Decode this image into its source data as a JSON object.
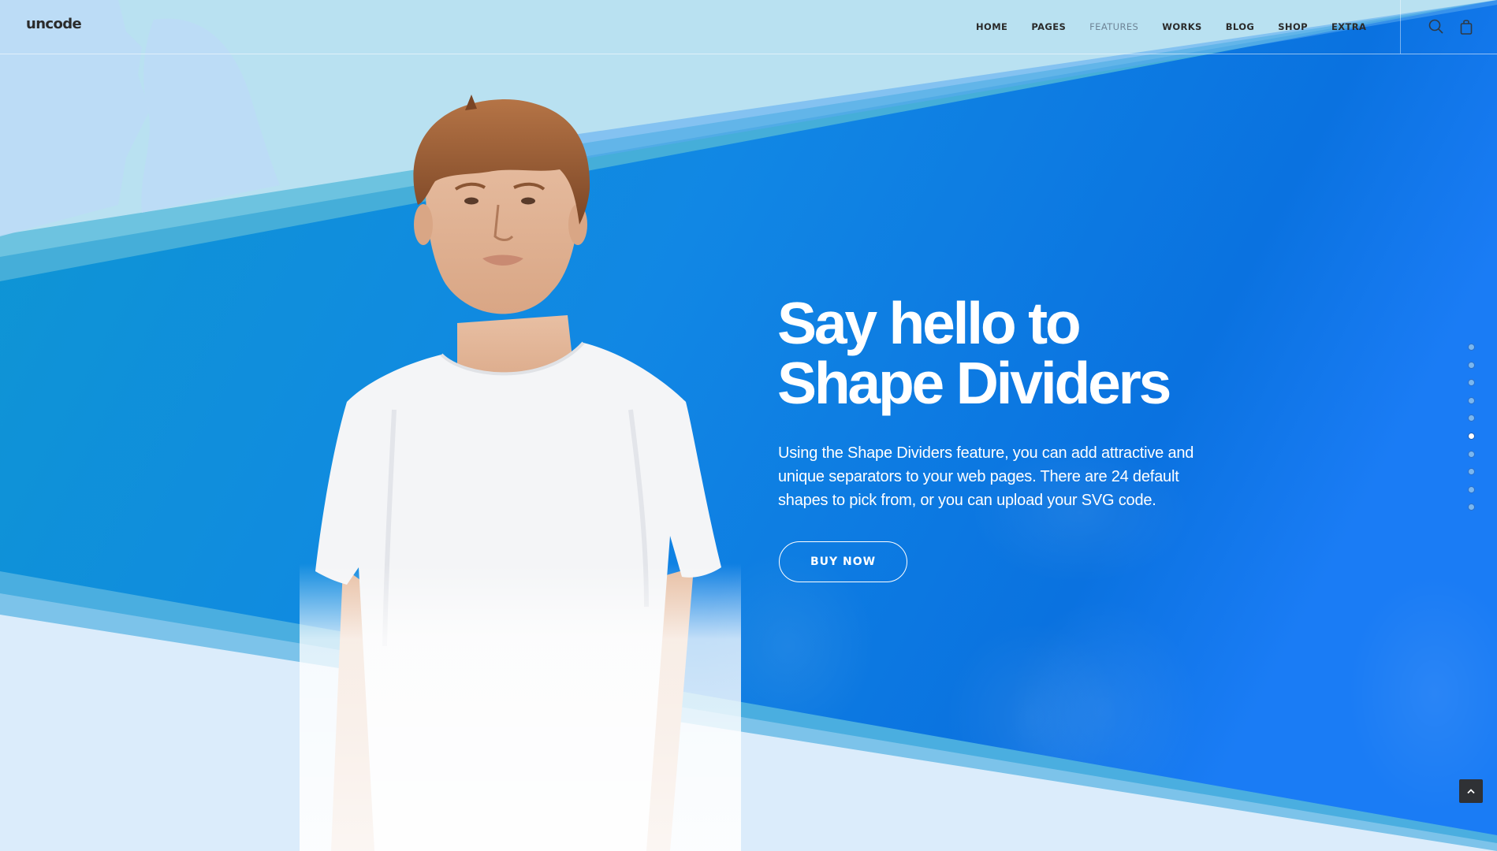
{
  "header": {
    "logo": "uncode",
    "nav": [
      {
        "label": "HOME",
        "active": false
      },
      {
        "label": "PAGES",
        "active": false
      },
      {
        "label": "FEATURES",
        "active": true
      },
      {
        "label": "WORKS",
        "active": false
      },
      {
        "label": "BLOG",
        "active": false
      },
      {
        "label": "SHOP",
        "active": false
      },
      {
        "label": "EXTRA",
        "active": false
      }
    ],
    "icons": {
      "search": "search-icon",
      "cart": "shopping-bag-icon"
    }
  },
  "hero": {
    "title_line1": "Say hello to",
    "title_line2": "Shape Dividers",
    "text": "Using the Shape Dividers feature, you can add attractive and unique separators to your web pages. There are 24 default shapes to pick from, or you can upload your SVG code.",
    "button_label": "BUY NOW"
  },
  "section_nav": {
    "count": 10,
    "active_index": 5
  },
  "back_to_top": {
    "icon": "chevron-up-icon"
  },
  "colors": {
    "top_light": "#b9e1f1",
    "bottom_light": "#dbecfb",
    "blue_left": "#0e97d2",
    "blue_right": "#1a7cf5",
    "band_1": "#6dc3e0",
    "band_2": "#45aed9",
    "text_dark": "#2a2a2a",
    "nav_active": "#6e8496",
    "button_dark": "#2f3135"
  }
}
